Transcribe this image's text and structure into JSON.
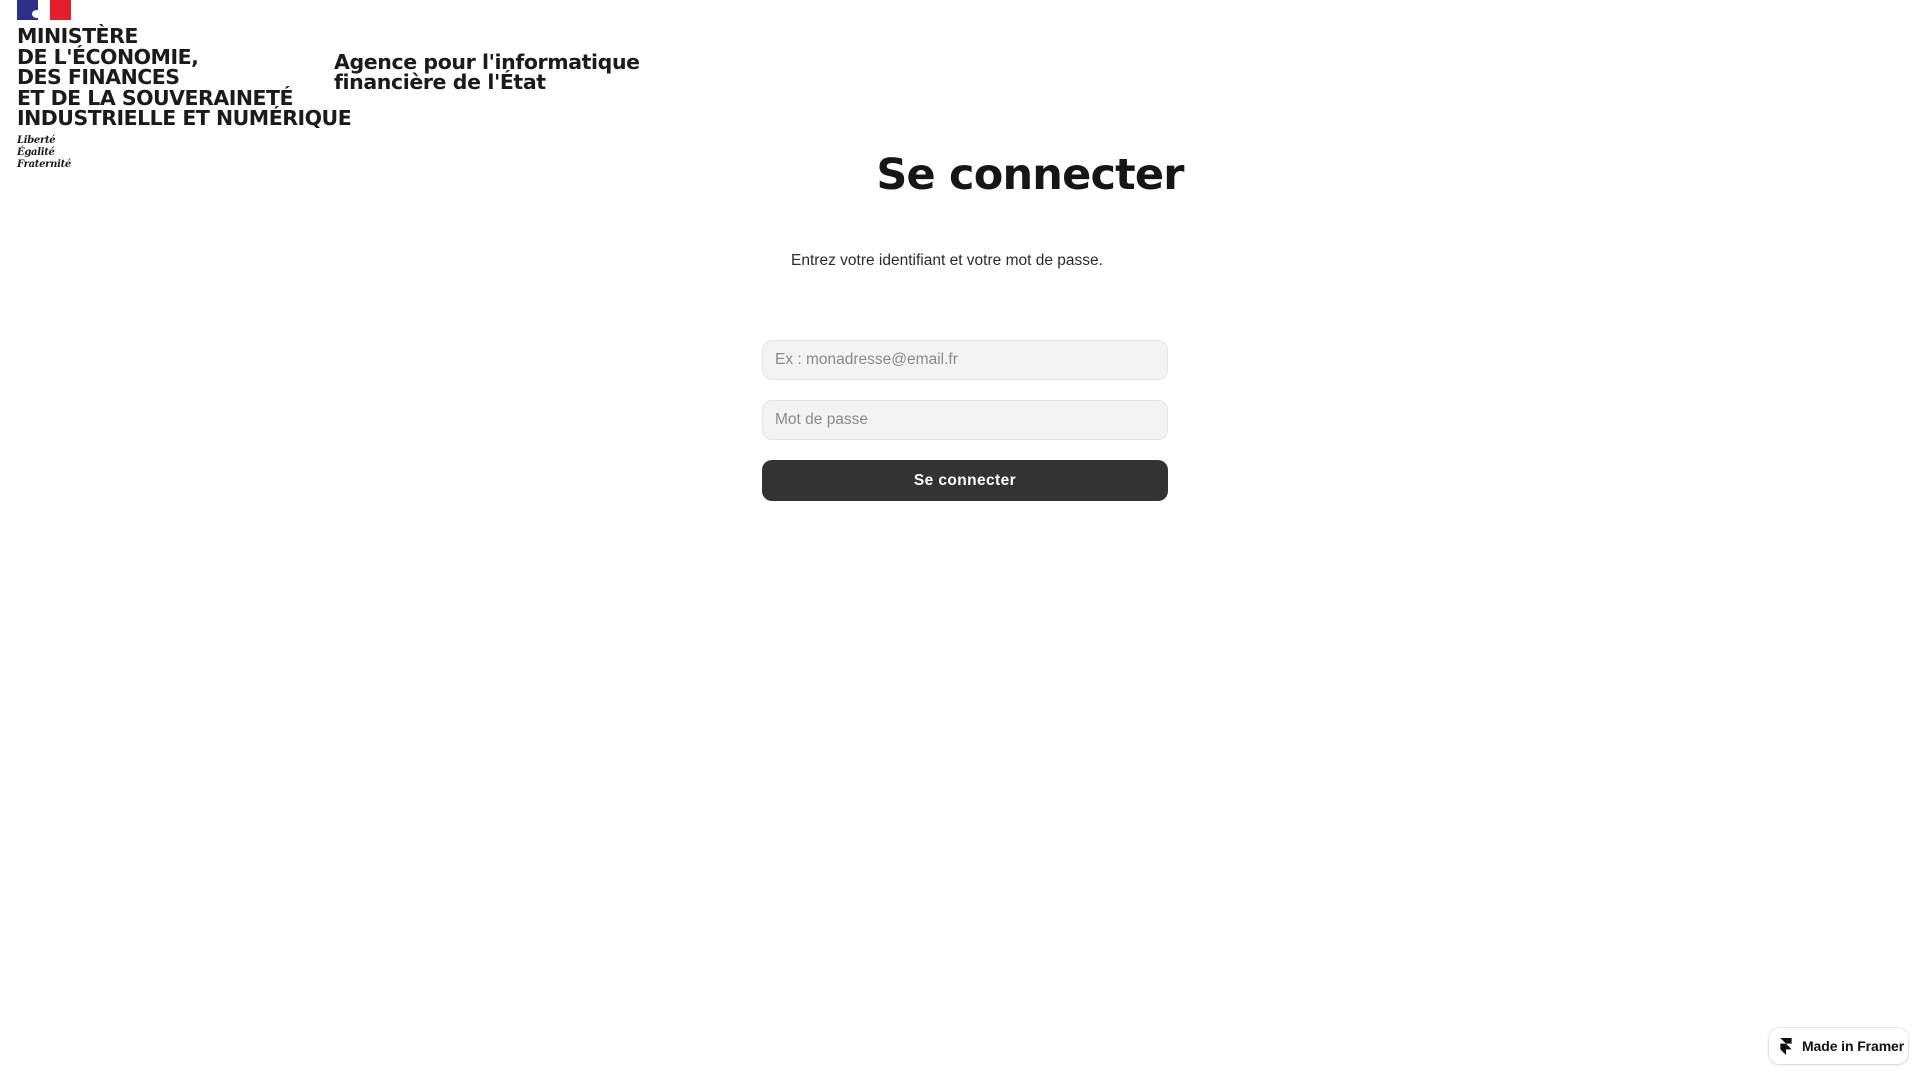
{
  "header": {
    "ministry_lines": [
      "MINISTÈRE",
      "DE L'ÉCONOMIE,",
      "DES FINANCES",
      "ET DE LA SOUVERAINETÉ",
      "INDUSTRIELLE ET NUMÉRIQUE"
    ],
    "motto": [
      "Liberté",
      "Égalité",
      "Fraternité"
    ],
    "agency_lines": [
      "Agence pour l'informatique",
      "financière de l'État"
    ],
    "flag_colors": {
      "blue": "#2b2f8a",
      "white": "#ffffff",
      "red": "#e3202a"
    }
  },
  "login": {
    "title": "Se connecter",
    "subtitle": "Entrez votre identifiant et votre mot de passe.",
    "email_placeholder": "Ex : monadresse@email.fr",
    "email_value": "",
    "password_placeholder": "Mot de passe",
    "password_value": "",
    "submit_label": "Se connecter",
    "button_color": "#333333"
  },
  "badge": {
    "label": "Made in Framer",
    "icon": "framer-icon"
  }
}
